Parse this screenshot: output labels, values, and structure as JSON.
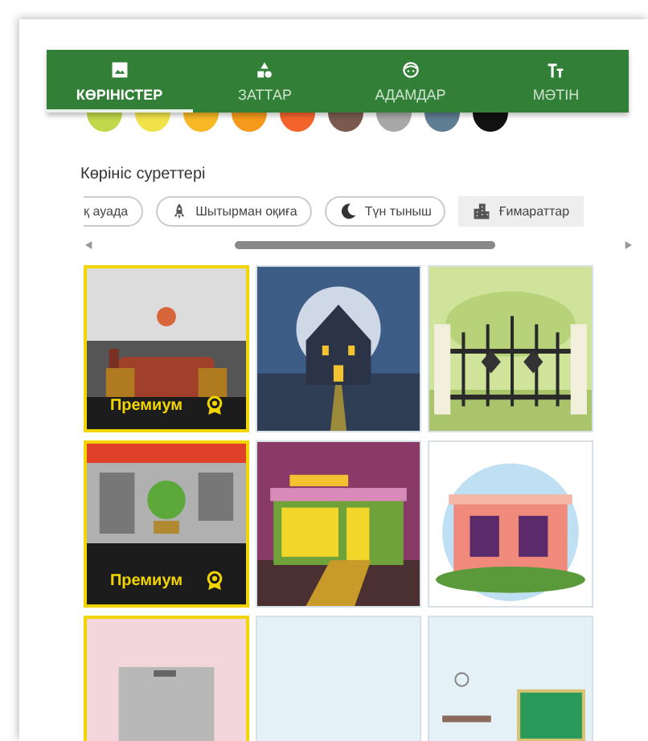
{
  "tabs": [
    {
      "label": "КӨРІНІСТЕР",
      "selected": true
    },
    {
      "label": "ЗАТТАР",
      "selected": false
    },
    {
      "label": "АДАМДАР",
      "selected": false
    },
    {
      "label": "МӘТІН",
      "selected": false
    }
  ],
  "swatches": [
    {
      "color": "#c0d84a"
    },
    {
      "color": "#f2e24a"
    },
    {
      "color": "#f7b825"
    },
    {
      "color": "#f59a1c"
    },
    {
      "color": "#f4632a"
    },
    {
      "color": "#7a5a4e"
    },
    {
      "color": "#a8a8a8"
    },
    {
      "color": "#5f7d93"
    },
    {
      "color": "#111111"
    }
  ],
  "section_title": "Көрініс суреттері",
  "chips": [
    {
      "label": "қ ауада",
      "selected": false
    },
    {
      "label": "Шытырман оқиға",
      "selected": false
    },
    {
      "label": "Түн тыныш",
      "selected": false
    },
    {
      "label": "Ғимараттар",
      "selected": true
    }
  ],
  "scenes": [
    {
      "kind": "picture",
      "premium": true,
      "badge": "Премиум"
    },
    {
      "kind": "picture",
      "premium": false
    },
    {
      "kind": "picture",
      "premium": false
    },
    {
      "kind": "picture",
      "premium": true,
      "badge": "Премиум"
    },
    {
      "kind": "picture",
      "premium": false
    },
    {
      "kind": "picture",
      "premium": false
    },
    {
      "kind": "picture",
      "premium": true
    },
    {
      "kind": "picture",
      "premium": false
    },
    {
      "kind": "picture",
      "premium": false
    }
  ]
}
